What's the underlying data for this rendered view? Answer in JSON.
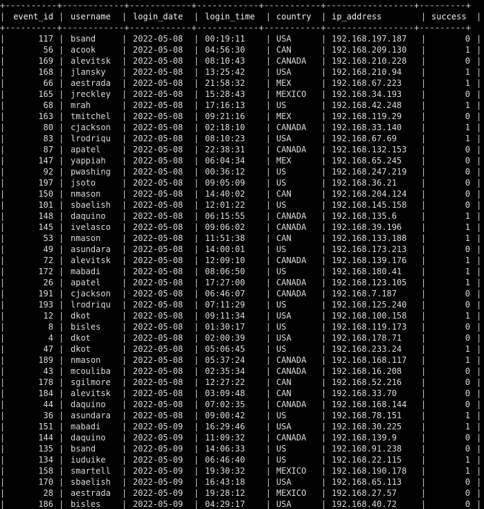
{
  "terminal": {
    "separator_top": "+----------+------------+------------+------------+-----------+-----------------+---------+",
    "separator_mid": "+----------+------------+------------+------------+-----------+-----------------+---------+",
    "headers": [
      "event_id",
      "username",
      "login_date",
      "login_time",
      "country",
      "ip_address",
      "success"
    ],
    "rows": [
      [
        "117",
        "bsand",
        "2022-05-08",
        "00:19:11",
        "USA",
        "192.168.197.187",
        "0"
      ],
      [
        "56",
        "acook",
        "2022-05-08",
        "04:56:30",
        "CAN",
        "192.168.209.130",
        "1"
      ],
      [
        "169",
        "alevitsk",
        "2022-05-08",
        "08:10:43",
        "CANADA",
        "192.168.210.228",
        "0"
      ],
      [
        "168",
        "jlansky",
        "2022-05-08",
        "13:25:42",
        "USA",
        "192.168.210.94",
        "1"
      ],
      [
        "66",
        "aestrada",
        "2022-05-08",
        "21:58:32",
        "MEX",
        "192.168.67.223",
        "1"
      ],
      [
        "165",
        "jreckley",
        "2022-05-08",
        "15:28:43",
        "MEXICO",
        "192.168.34.193",
        "0"
      ],
      [
        "68",
        "mrah",
        "2022-05-08",
        "17:16:13",
        "US",
        "192.168.42.248",
        "1"
      ],
      [
        "163",
        "tmitchel",
        "2022-05-08",
        "09:21:16",
        "MEX",
        "192.168.119.29",
        "0"
      ],
      [
        "80",
        "cjackson",
        "2022-05-08",
        "02:18:10",
        "CANADA",
        "192.168.33.140",
        "1"
      ],
      [
        "83",
        "lrodriqu",
        "2022-05-08",
        "08:10:23",
        "USA",
        "192.168.67.69",
        "1"
      ],
      [
        "87",
        "apatel",
        "2022-05-08",
        "22:38:31",
        "CANADA",
        "192.168.132.153",
        "0"
      ],
      [
        "147",
        "yappiah",
        "2022-05-08",
        "06:04:34",
        "MEX",
        "192.168.65.245",
        "0"
      ],
      [
        "92",
        "pwashing",
        "2022-05-08",
        "00:36:12",
        "US",
        "192.168.247.219",
        "0"
      ],
      [
        "197",
        "jsoto",
        "2022-05-08",
        "09:05:09",
        "US",
        "192.168.36.21",
        "0"
      ],
      [
        "150",
        "nmason",
        "2022-05-08",
        "14:40:02",
        "CAN",
        "192.168.204.124",
        "0"
      ],
      [
        "101",
        "sbaelish",
        "2022-05-08",
        "12:01:22",
        "US",
        "192.168.145.158",
        "0"
      ],
      [
        "148",
        "daquino",
        "2022-05-08",
        "06:15:55",
        "CANADA",
        "192.168.135.6",
        "1"
      ],
      [
        "145",
        "ivelasco",
        "2022-05-08",
        "09:06:02",
        "CANADA",
        "192.168.39.196",
        "1"
      ],
      [
        "53",
        "nmason",
        "2022-05-08",
        "11:51:38",
        "CAN",
        "192.168.133.188",
        "1"
      ],
      [
        "49",
        "asundara",
        "2022-05-08",
        "14:00:01",
        "US",
        "192.168.173.213",
        "0"
      ],
      [
        "72",
        "alevitsk",
        "2022-05-08",
        "12:09:10",
        "CANADA",
        "192.168.139.176",
        "1"
      ],
      [
        "172",
        "mabadi",
        "2022-05-08",
        "08:06:50",
        "US",
        "192.168.180.41",
        "1"
      ],
      [
        "26",
        "apatel",
        "2022-05-08",
        "17:27:00",
        "CANADA",
        "192.168.123.105",
        "1"
      ],
      [
        "191",
        "cjackson",
        "2022-05-08",
        "06:46:07",
        "CANADA",
        "192.168.7.187",
        "0"
      ],
      [
        "193",
        "lrodriqu",
        "2022-05-08",
        "07:11:29",
        "US",
        "192.168.125.240",
        "0"
      ],
      [
        "12",
        "dkot",
        "2022-05-08",
        "09:11:34",
        "USA",
        "192.168.100.158",
        "1"
      ],
      [
        "8",
        "bisles",
        "2022-05-08",
        "01:30:17",
        "US",
        "192.168.119.173",
        "0"
      ],
      [
        "4",
        "dkot",
        "2022-05-08",
        "02:00:39",
        "USA",
        "192.168.178.71",
        "0"
      ],
      [
        "47",
        "dkot",
        "2022-05-08",
        "05:06:45",
        "US",
        "192.168.233.24",
        "1"
      ],
      [
        "189",
        "nmason",
        "2022-05-08",
        "05:37:24",
        "CANADA",
        "192.168.168.117",
        "1"
      ],
      [
        "43",
        "mcouliba",
        "2022-05-08",
        "02:35:34",
        "CANADA",
        "192.168.16.208",
        "0"
      ],
      [
        "178",
        "sgilmore",
        "2022-05-08",
        "12:27:22",
        "CAN",
        "192.168.52.216",
        "0"
      ],
      [
        "184",
        "alevitsk",
        "2022-05-08",
        "03:09:48",
        "CAN",
        "192.168.33.70",
        "0"
      ],
      [
        "44",
        "daquino",
        "2022-05-08",
        "07:02:35",
        "CANADA",
        "192.168.168.144",
        "0"
      ],
      [
        "36",
        "asundara",
        "2022-05-08",
        "09:00:42",
        "US",
        "192.168.78.151",
        "1"
      ],
      [
        "151",
        "mabadi",
        "2022-05-09",
        "16:29:46",
        "USA",
        "192.168.30.225",
        "1"
      ],
      [
        "144",
        "daquino",
        "2022-05-09",
        "11:09:32",
        "CANADA",
        "192.168.139.9",
        "0"
      ],
      [
        "135",
        "bsand",
        "2022-05-09",
        "14:06:33",
        "US",
        "192.168.91.238",
        "0"
      ],
      [
        "134",
        "iuduike",
        "2022-05-09",
        "06:46:40",
        "US",
        "192.168.22.115",
        "1"
      ],
      [
        "158",
        "smartell",
        "2022-05-09",
        "19:30:32",
        "MEXICO",
        "192.168.190.178",
        "1"
      ],
      [
        "170",
        "sbaelish",
        "2022-05-09",
        "16:43:18",
        "USA",
        "192.168.65.113",
        "0"
      ],
      [
        "28",
        "aestrada",
        "2022-05-09",
        "19:28:12",
        "MEXICO",
        "192.168.27.57",
        "0"
      ],
      [
        "186",
        "bisles",
        "2022-05-09",
        "04:29:17",
        "USA",
        "192.168.40.72",
        "0"
      ]
    ]
  }
}
